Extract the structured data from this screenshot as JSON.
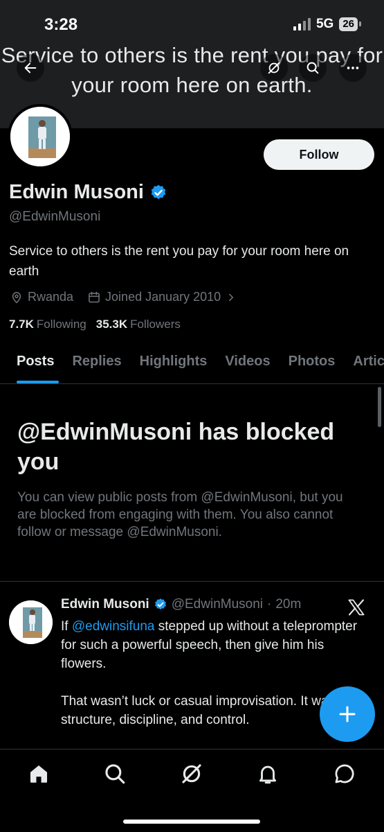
{
  "status_bar": {
    "time": "3:28",
    "network": "5G",
    "battery": "26"
  },
  "banner": {
    "text": "Service to others is the rent you pay for your room here on earth."
  },
  "header_icons": [
    "back-arrow-icon",
    "grok-icon",
    "search-icon",
    "more-icon"
  ],
  "profile": {
    "name": "Edwin Musoni",
    "handle": "@EdwinMusoni",
    "bio": "Service to others is the rent you pay for your room here on earth",
    "location": "Rwanda",
    "joined": "Joined January 2010",
    "following_count": "7.7K",
    "following_label": "Following",
    "followers_count": "35.3K",
    "followers_label": "Followers",
    "follow_button": "Follow",
    "verified_color": "#1d9bf0"
  },
  "tabs": [
    {
      "label": "Posts",
      "active": true
    },
    {
      "label": "Replies"
    },
    {
      "label": "Highlights"
    },
    {
      "label": "Videos"
    },
    {
      "label": "Photos"
    },
    {
      "label": "Articles"
    }
  ],
  "blocked": {
    "title": "@EdwinMusoni has blocked you",
    "description": "You can view public posts from @EdwinMusoni, but you are blocked from engaging with them. You also cannot follow or message @EdwinMusoni."
  },
  "post": {
    "name": "Edwin Musoni",
    "handle": "@EdwinMusoni",
    "separator": "·",
    "time": "20m",
    "text_prefix": "If ",
    "mention": "@edwinsifuna",
    "text_suffix": " stepped up without a teleprompter for such a powerful speech, then give him his flowers.",
    "text_second": "That wasn’t luck or casual improvisation. It was structure, discipline, and control."
  },
  "bottom_nav": [
    "home-icon",
    "search-icon",
    "grok-icon",
    "notifications-icon",
    "messages-icon"
  ],
  "colors": {
    "accent": "#1d9bf0",
    "background": "#000000",
    "muted": "#71767b"
  }
}
